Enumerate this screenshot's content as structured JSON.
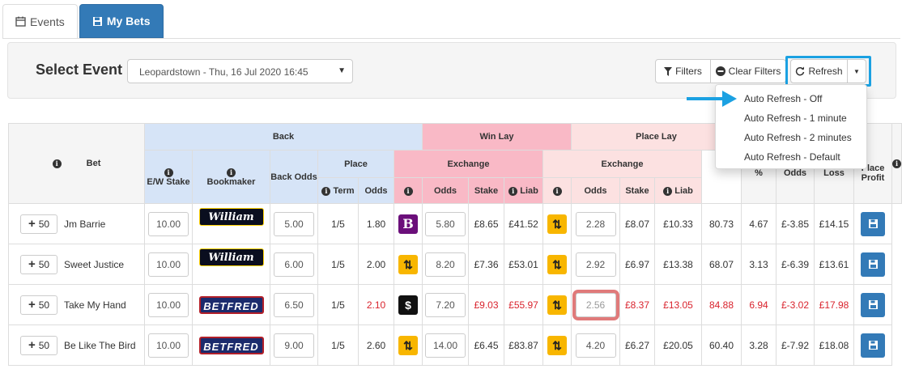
{
  "tabs": [
    {
      "label": "Events",
      "icon": "calendar-icon"
    },
    {
      "label": "My Bets",
      "icon": "save-icon"
    }
  ],
  "toolbar": {
    "select_label": "Select Event",
    "selected_event": "Leopardstown - Thu, 16 Jul 2020 16:45",
    "filters_label": "Filters",
    "clear_filters_label": "Clear Filters",
    "refresh_label": "Refresh"
  },
  "refresh_menu": [
    "Auto Refresh - Off",
    "Auto Refresh - 1 minute",
    "Auto Refresh - 2 minutes",
    "Auto Refresh - Default"
  ],
  "headers": {
    "bet": "Bet",
    "back": "Back",
    "win_lay": "Win Lay",
    "place_lay": "Place Lay",
    "ew_stake": "E/W Stake",
    "bookmaker": "Bookmaker",
    "back_odds": "Back Odds",
    "place": "Place",
    "exchange": "Exchange",
    "term": "Term",
    "odds": "Odds",
    "stake": "Stake",
    "liab": "Liab",
    "pct": "%",
    "col_odds": "Odds",
    "loss": "Loss",
    "place_profit": "Place Profit"
  },
  "rows": [
    {
      "plus": "50",
      "name": "Jm Barrie",
      "stake": "10.00",
      "bookmaker": "William HILL",
      "back_odds": "5.00",
      "term": "1/5",
      "place_odds": "1.80",
      "win_ex": "B",
      "win_odds": "5.80",
      "win_stake": "£8.65",
      "win_liab": "£41.52",
      "place_odds_in": "2.28",
      "place_stake": "£8.07",
      "place_liab": "£10.33",
      "pct": "80.73",
      "odds": "4.67",
      "loss": "£-3.85",
      "profit": "£14.15"
    },
    {
      "plus": "50",
      "name": "Sweet Justice",
      "stake": "10.00",
      "bookmaker": "William HILL",
      "back_odds": "6.00",
      "term": "1/5",
      "place_odds": "2.00",
      "win_ex": "",
      "win_odds": "8.20",
      "win_stake": "£7.36",
      "win_liab": "£53.01",
      "place_odds_in": "2.92",
      "place_stake": "£6.97",
      "place_liab": "£13.38",
      "pct": "68.07",
      "odds": "3.13",
      "loss": "£-6.39",
      "profit": "£13.61"
    },
    {
      "plus": "50",
      "name": "Take My Hand",
      "stake": "10.00",
      "bookmaker": "BETFRED",
      "back_odds": "6.50",
      "term": "1/5",
      "place_odds": "2.10",
      "win_ex": "$",
      "win_odds": "7.20",
      "win_stake": "£9.03",
      "win_liab": "£55.97",
      "place_odds_in": "2.56",
      "place_stake": "£8.37",
      "place_liab": "£13.05",
      "pct": "84.88",
      "odds": "6.94",
      "loss": "£-3.02",
      "profit": "£17.98"
    },
    {
      "plus": "50",
      "name": "Be Like The Bird",
      "stake": "10.00",
      "bookmaker": "BETFRED",
      "back_odds": "9.00",
      "term": "1/5",
      "place_odds": "2.60",
      "win_ex": "",
      "win_odds": "14.00",
      "win_stake": "£6.45",
      "win_liab": "£83.87",
      "place_odds_in": "4.20",
      "place_stake": "£6.27",
      "place_liab": "£20.05",
      "pct": "60.40",
      "odds": "3.28",
      "loss": "£-7.92",
      "profit": "£18.08"
    }
  ],
  "colors": {
    "primary": "#337ab7",
    "back": "#d6e4f7",
    "win_lay": "#f9b9c6",
    "place_lay": "#fce1e1",
    "highlight": "#1ba1e2",
    "red": "#d9232d"
  }
}
